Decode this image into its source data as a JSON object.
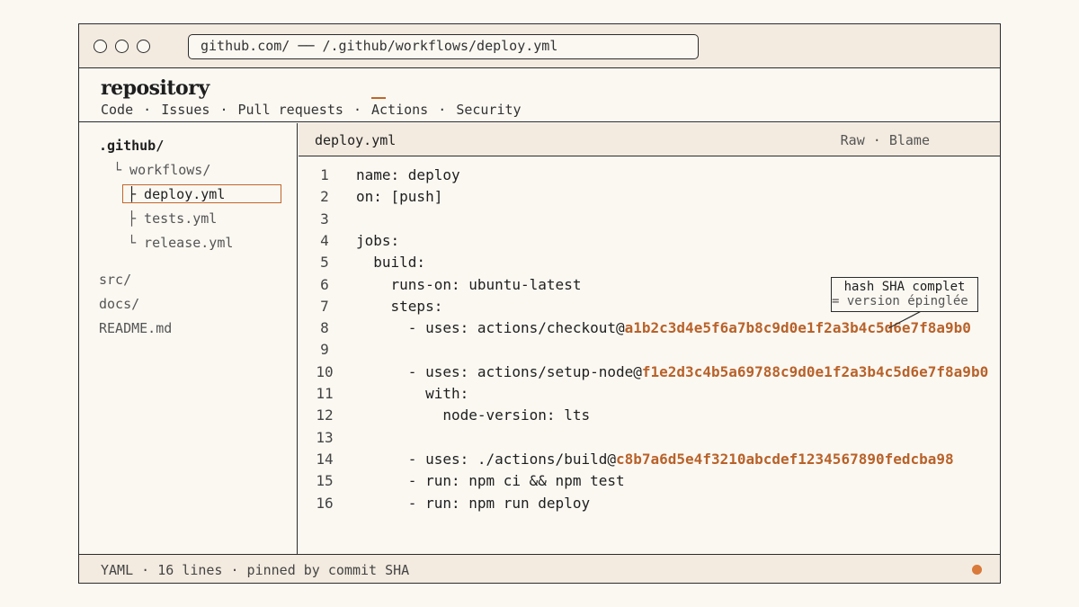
{
  "browser": {
    "url": "github.com/ ── /.github/workflows/deploy.yml"
  },
  "repo": {
    "title": "repository",
    "nav": [
      {
        "label": "Code",
        "active": false
      },
      {
        "label": "Issues",
        "active": false
      },
      {
        "label": "Pull requests",
        "active": false
      },
      {
        "label": "Actions",
        "active": true
      },
      {
        "label": "Security",
        "active": false
      }
    ],
    "separator": "·"
  },
  "tree": [
    {
      "label": ".github/",
      "type": "root"
    },
    {
      "label": "└ workflows/",
      "type": "folder"
    },
    {
      "label": "├ deploy.yml",
      "type": "file",
      "selected": true
    },
    {
      "label": "├ tests.yml",
      "type": "file"
    },
    {
      "label": "└ release.yml",
      "type": "file"
    },
    {
      "label": "src/",
      "type": "folder"
    },
    {
      "label": "docs/",
      "type": "folder"
    },
    {
      "label": "README.md",
      "type": "file"
    }
  ],
  "editor": {
    "filename": "deploy.yml",
    "actions": [
      "Raw",
      "Blame"
    ],
    "lines": [
      {
        "n": "1",
        "code": "name: deploy"
      },
      {
        "n": "2",
        "code": "on: [push]"
      },
      {
        "n": "3",
        "code": ""
      },
      {
        "n": "4",
        "code": "jobs:"
      },
      {
        "n": "5",
        "code": "  build:"
      },
      {
        "n": "6",
        "code": "    runs-on: ubuntu-latest"
      },
      {
        "n": "7",
        "code": "    steps:"
      },
      {
        "n": "8",
        "code": "      - uses: actions/checkout@",
        "sha": "a1b2c3d4e5f6a7b8c9d0e1f2a3b4c5d6e7f8a9b0"
      },
      {
        "n": "9",
        "code": ""
      },
      {
        "n": "10",
        "code": "      - uses: actions/setup-node@",
        "sha": "f1e2d3c4b5a69788c9d0e1f2a3b4c5d6e7f8a9b0"
      },
      {
        "n": "11",
        "code": "        with:"
      },
      {
        "n": "12",
        "code": "          node-version: lts"
      },
      {
        "n": "13",
        "code": ""
      },
      {
        "n": "14",
        "code": "      - uses: ./actions/build@",
        "sha": "c8b7a6d5e4f3210abcdef1234567890fedcba98"
      },
      {
        "n": "15",
        "code": "      - run: npm ci && npm test"
      },
      {
        "n": "16",
        "code": "      - run: npm run deploy"
      }
    ]
  },
  "annotation": {
    "title": "hash SHA complet",
    "subtitle": "= version épinglée"
  },
  "status": {
    "text": "YAML · 16 lines · pinned by commit SHA"
  },
  "colors": {
    "accent": "#c0662a",
    "sha": "#b8622a",
    "status_dot": "#d9793a"
  }
}
